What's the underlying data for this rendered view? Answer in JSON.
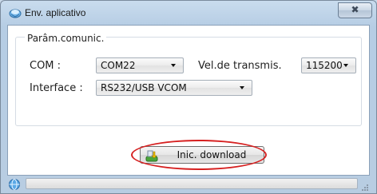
{
  "window": {
    "title": "Env. aplicativo",
    "close_glyph": "✖",
    "title_icon": "transfer-icon"
  },
  "comm_group": {
    "legend": "Parâm.comunic.",
    "com_label": "COM :",
    "com_value": "COM22",
    "baud_label": "Vel.de transmis.",
    "baud_value": "115200",
    "interface_label": "Interface :",
    "interface_value": "RS232/USB VCOM"
  },
  "download_button": {
    "label": "Inic. download",
    "icon": "download-icon"
  },
  "status": {
    "progress": 0,
    "status_icon": "status-globe-icon"
  },
  "colors": {
    "highlight": "#d62020",
    "title_background": "#c9dcee",
    "progress_fill": "#3fb83f"
  }
}
